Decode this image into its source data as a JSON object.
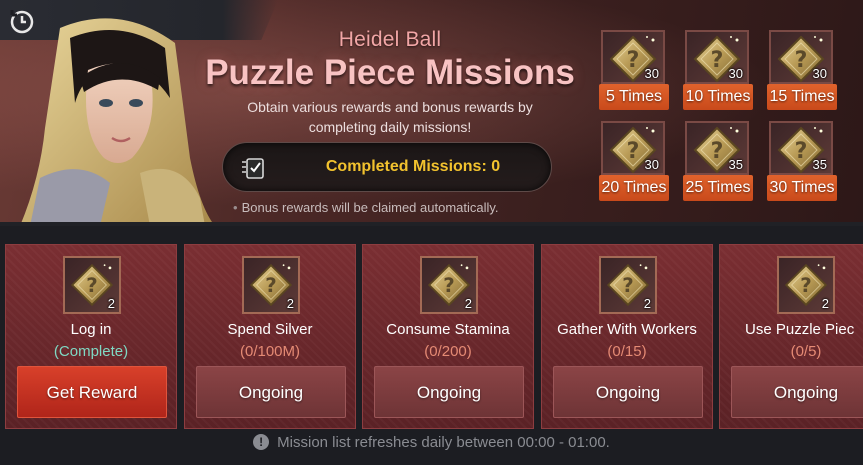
{
  "header": {
    "event_name": "Heidel Ball",
    "title": "Puzzle Piece Missions",
    "subtitle_line1": "Obtain various rewards and bonus rewards by",
    "subtitle_line2": "completing daily missions!",
    "completed_label": "Completed Missions: 0",
    "note": "Bonus rewards will be claimed automatically.",
    "note_bullet": "•"
  },
  "bonus_rewards": [
    {
      "count": "30",
      "label": "5 Times"
    },
    {
      "count": "30",
      "label": "10 Times"
    },
    {
      "count": "30",
      "label": "15 Times"
    },
    {
      "count": "30",
      "label": "20 Times"
    },
    {
      "count": "35",
      "label": "25 Times"
    },
    {
      "count": "35",
      "label": "30 Times"
    }
  ],
  "missions": [
    {
      "count": "2",
      "name": "Log in",
      "status": "(Complete)",
      "button": "Get Reward"
    },
    {
      "count": "2",
      "name": "Spend Silver",
      "status": "(0/100M)",
      "button": "Ongoing"
    },
    {
      "count": "2",
      "name": "Consume Stamina",
      "status": "(0/200)",
      "button": "Ongoing"
    },
    {
      "count": "2",
      "name": "Gather With Workers",
      "status": "(0/15)",
      "button": "Ongoing"
    },
    {
      "count": "2",
      "name": "Use Puzzle Piec",
      "status": "(0/5)",
      "button": "Ongoing"
    }
  ],
  "footer": {
    "info_glyph": "!",
    "text": "Mission list refreshes daily between 00:00 - 01:00."
  },
  "icons": {
    "clock": "clock-icon",
    "check": "mission-check-icon",
    "puzzle": "puzzle-piece-icon",
    "info": "info-icon"
  },
  "colors": {
    "accent_orange": "#e0622c",
    "completed_text": "#f2c22e",
    "status_complete": "#7fd9c4",
    "status_progress": "#e58a74",
    "reward_button": "#d8402a"
  }
}
